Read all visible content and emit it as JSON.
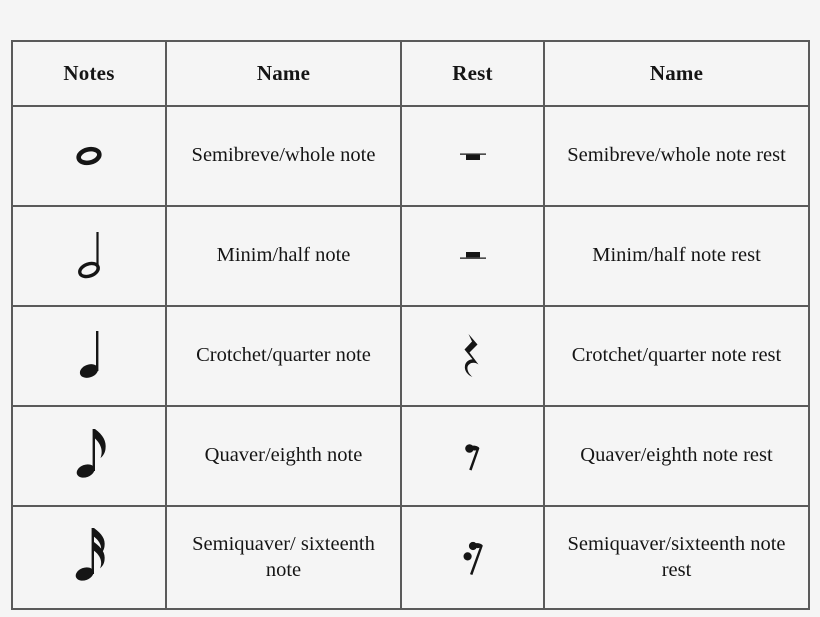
{
  "table": {
    "headers": [
      {
        "label": "Notes",
        "name": "header-notes"
      },
      {
        "label": "Name",
        "name": "header-name-note"
      },
      {
        "label": "Rest",
        "name": "header-rest"
      },
      {
        "label": "Name",
        "name": "header-name-rest"
      }
    ],
    "rows": [
      {
        "note_icon": "whole-note-icon",
        "note_name": "Semibreve/whole note",
        "rest_icon": "whole-rest-icon",
        "rest_name": "Semibreve/whole note rest"
      },
      {
        "note_icon": "half-note-icon",
        "note_name": "Minim/half note",
        "rest_icon": "half-rest-icon",
        "rest_name": "Minim/half note rest"
      },
      {
        "note_icon": "quarter-note-icon",
        "note_name": "Crotchet/quarter note",
        "rest_icon": "quarter-rest-icon",
        "rest_name": "Crotchet/quarter note rest"
      },
      {
        "note_icon": "eighth-note-icon",
        "note_name": "Quaver/eighth note",
        "rest_icon": "eighth-rest-icon",
        "rest_name": "Quaver/eighth note rest"
      },
      {
        "note_icon": "sixteenth-note-icon",
        "note_name": "Semiquaver/ sixteenth note",
        "rest_icon": "sixteenth-rest-icon",
        "rest_name": "Semiquaver/sixteenth note rest"
      }
    ]
  },
  "colors": {
    "background": "#f5f5f5",
    "border": "#5a5a5a",
    "ink": "#151515"
  }
}
